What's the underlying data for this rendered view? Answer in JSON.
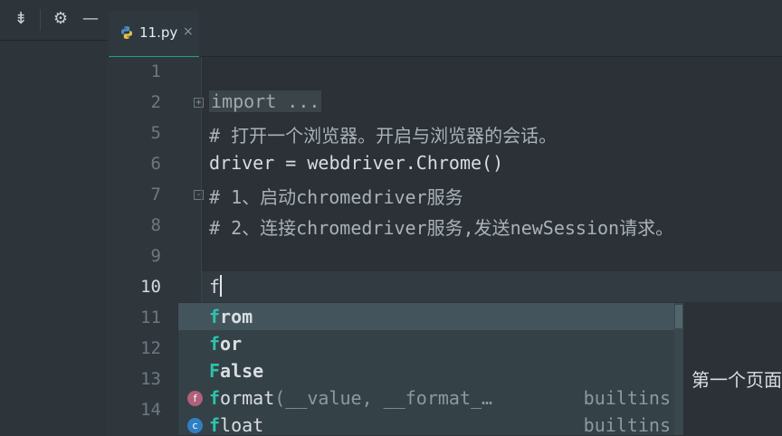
{
  "toolbar": {
    "icons": [
      "collapse-all-icon",
      "gear-icon",
      "minimize-icon"
    ],
    "glyphs": {
      "collapse": "⇟",
      "gear": "⚙",
      "minimize": "—"
    }
  },
  "tab": {
    "label": "11.py",
    "close": "×",
    "icon": "python-file-icon"
  },
  "gutter": {
    "lines": [
      "1",
      "2",
      "5",
      "6",
      "7",
      "8",
      "9",
      "10",
      "11",
      "12",
      "13",
      "14"
    ],
    "active_line": "10"
  },
  "code": {
    "line2_fold": "import ...",
    "line5": "# 打开一个浏览器。开启与浏览器的会话。",
    "line6": "driver = webdriver.Chrome()",
    "line7": "# 1、启动chromedriver服务",
    "line8": "# 2、连接chromedriver服务,发送newSession请求。",
    "line10": "f"
  },
  "completion": {
    "items": [
      {
        "match": "f",
        "rest": "rom",
        "params": "",
        "location": "",
        "badge": ""
      },
      {
        "match": "f",
        "rest": "or",
        "params": "",
        "location": "",
        "badge": ""
      },
      {
        "match": "F",
        "rest": "alse",
        "params": "",
        "location": "",
        "badge": ""
      },
      {
        "match": "f",
        "rest": "ormat",
        "params": "(__value, __format_…",
        "location": "builtins",
        "badge": "f"
      },
      {
        "match": "f",
        "rest": "loat",
        "params": "",
        "location": "builtins",
        "badge": "c"
      }
    ],
    "badge_colors": {
      "f": "#b25f7a",
      "c": "#2f7fc2"
    }
  },
  "behind_text": "第一个页面"
}
